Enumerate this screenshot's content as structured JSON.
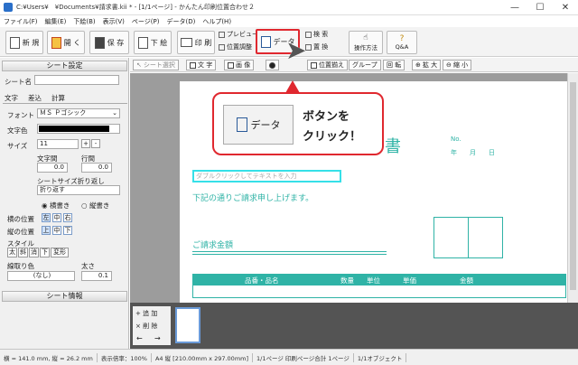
{
  "window": {
    "title": "C:¥Users¥　¥Documents¥請求書.kii * - [1/1ページ] - かんたん印刷位置合わせ２"
  },
  "menu": [
    "ファイル(F)",
    "編集(E)",
    "下絵(B)",
    "表示(V)",
    "ページ(P)",
    "データ(D)",
    "ヘルプ(H)"
  ],
  "ribbon": {
    "new": "新 規",
    "open": "開 く",
    "save": "保 存",
    "underlay": "下 絵",
    "print": "印 刷",
    "preview": "プレビュー",
    "position_adjust": "位置調整",
    "data": "データ",
    "search": "検 索",
    "replace": "置 換",
    "howto": "操作方法",
    "qa": "Q&A"
  },
  "leftpanel": {
    "header": "シート設定",
    "sheet_name_label": "シート名",
    "tabs": [
      "文字",
      "差込",
      "計算"
    ],
    "font_label": "フォント",
    "font_value": "ＭＳ Ｐゴシック",
    "color_label": "文字色",
    "size_label": "サイズ",
    "size_value": "11",
    "plus": "+",
    "minus": "-",
    "char_spacing_label": "文字間",
    "char_spacing_value": "0.0",
    "line_spacing_label": "行間",
    "line_spacing_value": "0.0",
    "wrap_label": "シートサイズ折り返し",
    "wrap_value": "折り返す",
    "horizontal": "横書き",
    "vertical": "縦書き",
    "halign_label": "横の位置",
    "halign": [
      "左",
      "中",
      "右"
    ],
    "valign_label": "縦の位置",
    "valign": [
      "上",
      "中",
      "下"
    ],
    "style_label": "スタイル",
    "styles": [
      "太",
      "斜",
      "消",
      "下",
      "変形"
    ],
    "border_color_label": "線取り色",
    "border_color_value": "(なし)",
    "thickness_label": "太さ",
    "thickness_value": "0.1",
    "footer": "シート情報"
  },
  "editor_toolbar": {
    "sheet_select": "シート選択",
    "text": "文 字",
    "image": "画 像",
    "align": "位置揃え",
    "group": "グループ",
    "rotate": "回 転",
    "zoom_in": "拡 大",
    "zoom_out": "縮 小"
  },
  "paper": {
    "title_char": "書",
    "no_label": "No.",
    "date_label": "年　　月　　日",
    "placeholder": "ダブルクリックしてテキストを入力",
    "intro": "下記の通りご請求申し上げます。",
    "amount_label": "ご請求金額",
    "table_headers": [
      "品番・品名",
      "数量",
      "単位",
      "単価",
      "金額"
    ]
  },
  "callout": {
    "button_label": "データ",
    "instruction_line1": "ボタンを",
    "instruction_line2": "クリック！"
  },
  "thumbbar": {
    "add": "追 加",
    "delete": "削 除"
  },
  "status": [
    "横 = 141.0 mm, 縦 = 26.2 mm",
    "表示倍率：100%",
    "A4 縦 [210.00mm x 297.00mm]",
    "1/1ページ 印刷ページ合計 1ページ",
    "1/1オブジェクト"
  ],
  "colors": {
    "accent": "#2fb3a6",
    "highlight": "#e0282f"
  }
}
